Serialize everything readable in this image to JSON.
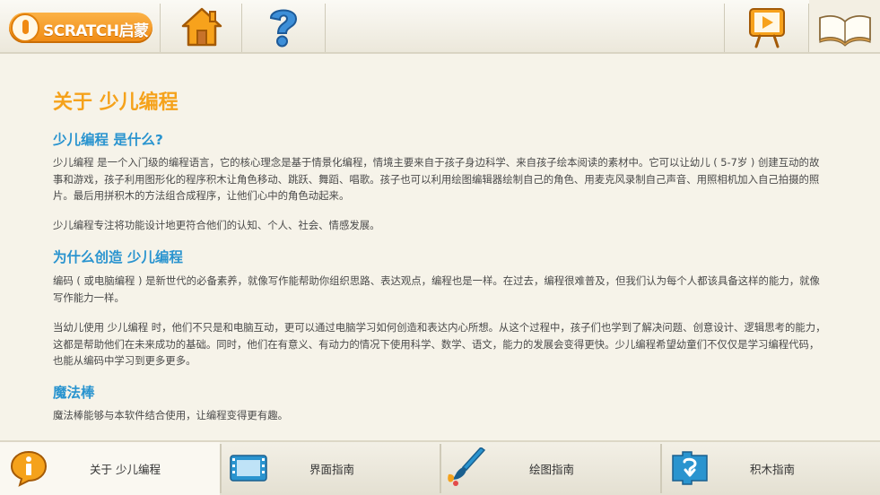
{
  "topbar": {
    "logo_text": "SCRATCH启蒙"
  },
  "content": {
    "title": "关于 少儿编程",
    "sections": [
      {
        "heading": "少儿编程 是什么?",
        "paragraphs": [
          "少儿编程 是一个入门级的编程语言，它的核心理念是基于情景化编程，情境主要来自于孩子身边科学、来自孩子绘本阅读的素材中。它可以让幼儿 ( 5-7岁 ) 创建互动的故事和游戏，孩子利用图形化的程序积木让角色移动、跳跃、舞蹈、唱歌。孩子也可以利用绘图编辑器绘制自己的角色、用麦克风录制自己声音、用照相机加入自己拍摄的照片。最后用拼积木的方法组合成程序，让他们心中的角色动起来。",
          "少儿编程专注将功能设计地更符合他们的认知、个人、社会、情感发展。"
        ]
      },
      {
        "heading": "为什么创造 少儿编程",
        "paragraphs": [
          "编码 ( 或电脑编程 ) 是新世代的必备素养，就像写作能帮助你组织思路、表达观点，编程也是一样。在过去，编程很难普及，但我们认为每个人都该具备这样的能力，就像写作能力一样。",
          "当幼儿使用 少儿编程 时，他们不只是和电脑互动，更可以通过电脑学习如何创造和表达内心所想。从这个过程中，孩子们也学到了解决问题、创意设计、逻辑思考的能力，这都是帮助他们在未来成功的基础。同时，他们在有意义、有动力的情况下使用科学、数学、语文，能力的发展会变得更快。少儿编程希望幼童们不仅仅是学习编程代码，也能从编码中学习到更多更多。"
        ]
      },
      {
        "heading": "魔法棒",
        "paragraphs": [
          "魔法棒能够与本软件结合使用，让编程变得更有趣。"
        ]
      }
    ]
  },
  "bottombar": {
    "tabs": [
      {
        "label": "关于 少儿编程",
        "icon": "info-icon"
      },
      {
        "label": "界面指南",
        "icon": "film-icon"
      },
      {
        "label": "绘图指南",
        "icon": "paintbrush-icon"
      },
      {
        "label": "积木指南",
        "icon": "block-icon"
      }
    ]
  },
  "colors": {
    "title": "#f5a21b",
    "heading": "#2a94cf",
    "body_text": "#4a4a4a",
    "background": "#f6f3e9"
  }
}
